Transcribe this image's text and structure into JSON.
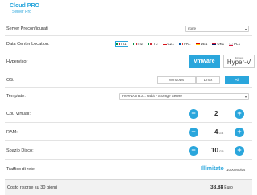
{
  "brand": {
    "title": "Cloud PRO",
    "subtitle": "Server Pro"
  },
  "preconfigured": {
    "label": "Server Preconfigurati",
    "value": "none"
  },
  "datacenter": {
    "label": "Data Center Location:",
    "options": [
      {
        "code": "IT1",
        "selected": true
      },
      {
        "code": "IT2",
        "selected": false
      },
      {
        "code": "IT3",
        "selected": false
      },
      {
        "code": "CZ1",
        "selected": false
      },
      {
        "code": "FR1",
        "selected": false
      },
      {
        "code": "DE1",
        "selected": false
      },
      {
        "code": "UK1",
        "selected": false
      },
      {
        "code": "PL1",
        "selected": false
      }
    ]
  },
  "hypervisor": {
    "label": "Hypervisor",
    "vmware": "vmware",
    "hyperv_small": "Microsoft",
    "hyperv": "Hyper-V"
  },
  "os": {
    "label": "OS:",
    "windows": "Windows",
    "linux": "Linux",
    "all": "All"
  },
  "template": {
    "label": "Template:",
    "value": "FreeNAS 8.0.1 64bit - Storage Server"
  },
  "cpu": {
    "label": "Cpu Virtuali:",
    "value": "2"
  },
  "ram": {
    "label": "RAM:",
    "value": "4",
    "unit": "GB"
  },
  "disk": {
    "label": "Spazio Disco:",
    "value": "10",
    "unit": "GB"
  },
  "traffic": {
    "label": "Traffico di rete:",
    "value": "Illimitato",
    "unit": "1000 Mbit/s"
  },
  "total": {
    "label": "Costo risorse su 30 giorni",
    "value": "38,88",
    "currency": "Euro"
  },
  "colors": {
    "accent": "#2aa6dc"
  },
  "icons": {
    "minus": "−",
    "plus": "+"
  }
}
